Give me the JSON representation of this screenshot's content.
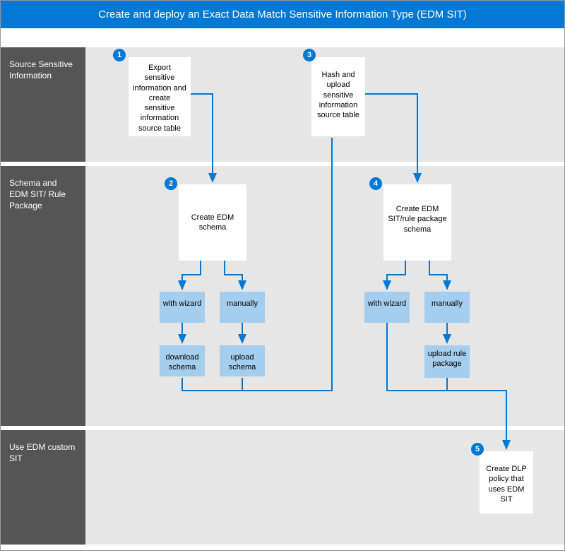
{
  "header": {
    "title": "Create and deploy an Exact Data Match Sensitive Information Type (EDM SIT)"
  },
  "lanes": {
    "l1": "Source Sensitive Information",
    "l2": "Schema and EDM SIT/ Rule Package",
    "l3": "Use EDM custom SIT"
  },
  "nodes": {
    "n1": {
      "badge": "1",
      "text": "Export sensitive information and create sensitive information source table"
    },
    "n2": {
      "badge": "2",
      "text": "Create EDM schema"
    },
    "n3": {
      "badge": "3",
      "text": "Hash and upload sensitive information source table"
    },
    "n4": {
      "badge": "4",
      "text": "Create EDM SIT/rule package schema"
    },
    "n5": {
      "badge": "5",
      "text": "Create DLP policy that uses EDM SIT"
    },
    "n2a": "with wizard",
    "n2b": "manually",
    "n2a2": "download schema",
    "n2b2": "upload schema",
    "n4a": "with wizard",
    "n4b": "manually",
    "n4b2": "upload rule package"
  },
  "colors": {
    "brand": "#0078d4",
    "laneBg": "#e6e6e6",
    "labelBg": "#555555",
    "subNode": "#a5cdee"
  }
}
